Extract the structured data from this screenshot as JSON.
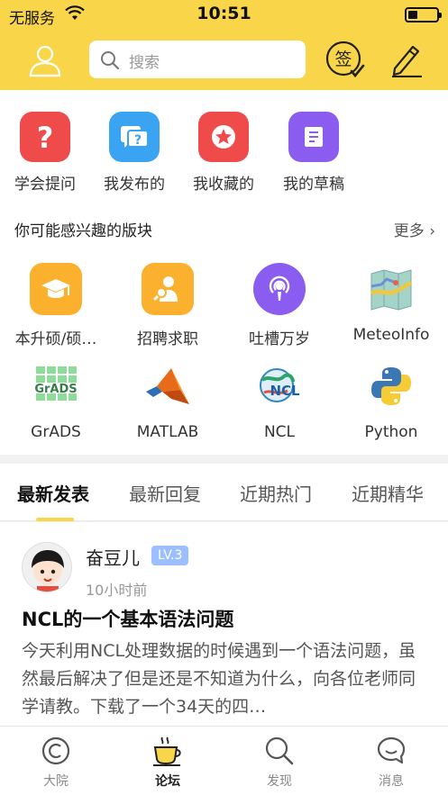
{
  "status_bar": {
    "carrier": "无服务",
    "time": "10:51"
  },
  "header": {
    "search_placeholder": "搜索",
    "sign_glyph": "签"
  },
  "quick_actions": [
    {
      "label": "学会提问",
      "color": "#ef4b4b",
      "icon": "question-icon"
    },
    {
      "label": "我发布的",
      "color": "#3aa4f2",
      "icon": "chat-question-icon"
    },
    {
      "label": "我收藏的",
      "color": "#ef4b4b",
      "icon": "star-icon"
    },
    {
      "label": "我的草稿",
      "color": "#8a5cf0",
      "icon": "draft-icon"
    }
  ],
  "section": {
    "title": "你可能感兴趣的版块",
    "more": "更多"
  },
  "forums": [
    {
      "label": "本升硕/硕…",
      "icon": "graduation-cap-icon"
    },
    {
      "label": "招聘求职",
      "icon": "job-search-icon"
    },
    {
      "label": "吐槽万岁",
      "icon": "podcast-icon"
    },
    {
      "label": "MeteoInfo",
      "icon": "map-icon"
    },
    {
      "label": "GrADS",
      "icon": "grads-logo",
      "logo_text": "GrADS"
    },
    {
      "label": "MATLAB",
      "icon": "matlab-logo"
    },
    {
      "label": "NCL",
      "icon": "ncl-logo",
      "logo_text": "NCL"
    },
    {
      "label": "Python",
      "icon": "python-logo"
    }
  ],
  "tabs": [
    {
      "label": "最新发表",
      "active": true
    },
    {
      "label": "最新回复",
      "active": false
    },
    {
      "label": "近期热门",
      "active": false
    },
    {
      "label": "近期精华",
      "active": false
    }
  ],
  "post": {
    "author": "奋豆儿",
    "level": "LV.3",
    "time": "10小时前",
    "title": "NCL的一个基本语法问题",
    "excerpt": "今天利用NCL处理数据的时候遇到一个语法问题，虽然最后解决了但是还是不知道为什么，向各位老师同学请教。下载了一个34天的四…"
  },
  "bottom_nav": [
    {
      "label": "大院",
      "active": false
    },
    {
      "label": "论坛",
      "active": true
    },
    {
      "label": "发现",
      "active": false
    },
    {
      "label": "消息",
      "active": false
    }
  ],
  "colors": {
    "accent": "#f9d649",
    "level_badge": "#9cc0ff"
  }
}
